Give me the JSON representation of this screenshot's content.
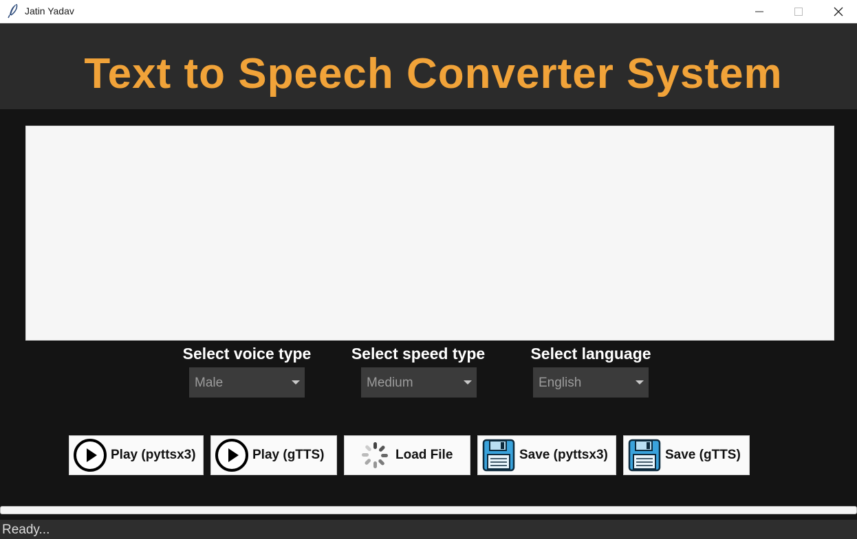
{
  "window": {
    "title": "Jatin Yadav",
    "icon": "feather-icon"
  },
  "header": {
    "title": "Text to Speech Converter System",
    "title_color": "#f1a339",
    "background": "#2b2b2b"
  },
  "editor": {
    "value": ""
  },
  "selectors": {
    "voice": {
      "label": "Select voice type",
      "value": "Male"
    },
    "speed": {
      "label": "Select speed type",
      "value": "Medium"
    },
    "language": {
      "label": "Select language",
      "value": "English"
    }
  },
  "buttons": {
    "play_pyttsx3": {
      "label": "Play (pyttsx3)",
      "icon": "play-icon"
    },
    "play_gtts": {
      "label": "Play (gTTS)",
      "icon": "play-icon"
    },
    "load_file": {
      "label": "Load File",
      "icon": "spinner-icon"
    },
    "save_pyttsx3": {
      "label": "Save (pyttsx3)",
      "icon": "floppy-disk-icon"
    },
    "save_gtts": {
      "label": "Save (gTTS)",
      "icon": "floppy-disk-icon"
    }
  },
  "progress": {
    "value": 0
  },
  "status": {
    "text": "Ready..."
  }
}
